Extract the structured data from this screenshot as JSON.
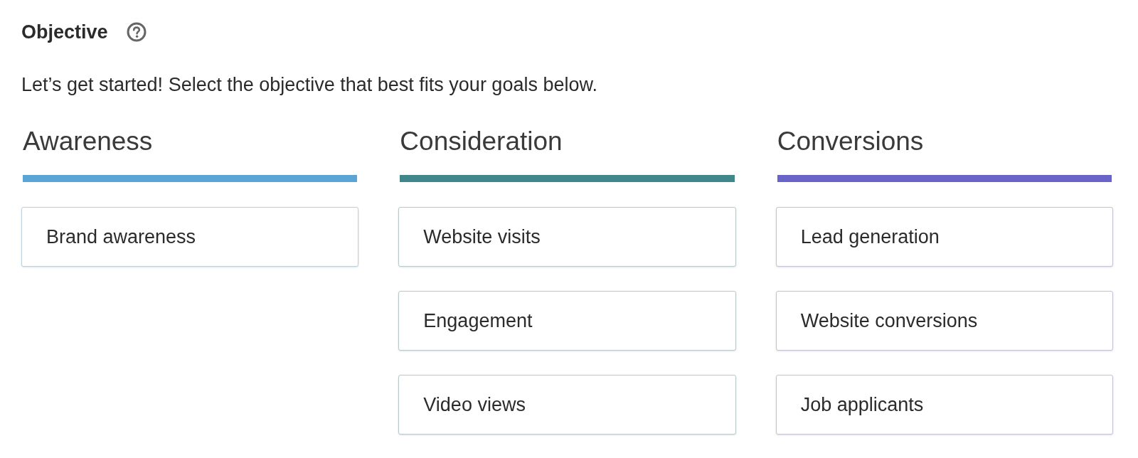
{
  "title": "Objective",
  "description": "Let’s get started! Select the objective that best fits your goals below.",
  "columns": [
    {
      "heading": "Awareness",
      "color": "#5ba5d6",
      "options": [
        "Brand awareness"
      ]
    },
    {
      "heading": "Consideration",
      "color": "#3f878a",
      "options": [
        "Website visits",
        "Engagement",
        "Video views"
      ]
    },
    {
      "heading": "Conversions",
      "color": "#6b64c8",
      "options": [
        "Lead generation",
        "Website conversions",
        "Job applicants"
      ]
    }
  ]
}
